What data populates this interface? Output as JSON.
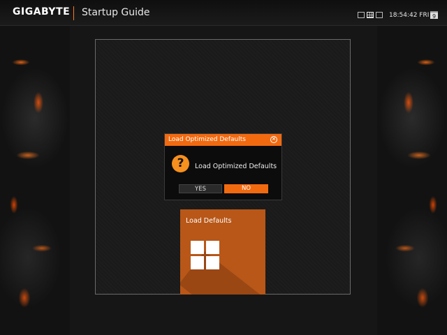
{
  "topbar": {
    "brand": "GIGABYTE",
    "title": "Startup Guide",
    "clock": "18:54:42 FRI",
    "calendar_day": "9"
  },
  "dialog": {
    "title": "Load Optimized Defaults",
    "message": "Load Optimized Defaults",
    "yes_label": "YES",
    "no_label": "NO",
    "icon_char": "?"
  },
  "tile": {
    "label": "Load Defaults"
  },
  "colors": {
    "accent": "#f26a10",
    "tile": "#b85718",
    "background": "#161616"
  },
  "icons": {
    "view_icons": [
      "single-view-icon",
      "grid-view-icon",
      "window-view-icon"
    ],
    "calendar": "calendar-icon",
    "close": "close-icon",
    "question": "question-icon",
    "tile_icon": "windows-grid-icon"
  }
}
